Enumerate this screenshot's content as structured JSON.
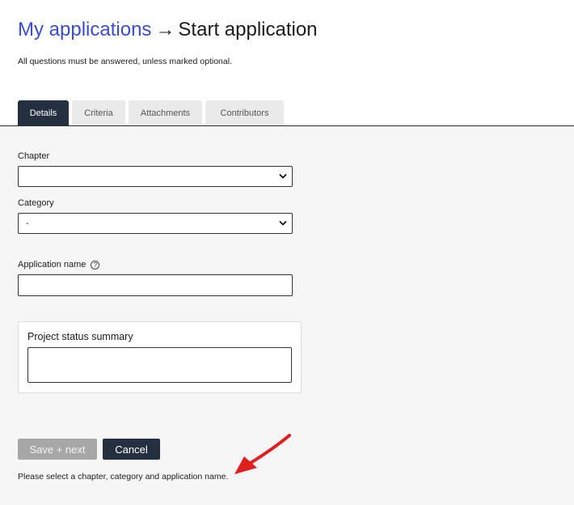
{
  "header": {
    "breadcrumb_link": "My applications",
    "arrow": "→",
    "current": "Start application"
  },
  "intro_text": "All questions must be answered, unless marked optional.",
  "tabs": [
    {
      "label": "Details",
      "active": true
    },
    {
      "label": "Criteria",
      "active": false
    },
    {
      "label": "Attachments",
      "active": false
    },
    {
      "label": "Contributors",
      "active": false
    }
  ],
  "form": {
    "chapter": {
      "label": "Chapter",
      "value": ""
    },
    "category": {
      "label": "Category",
      "value": "-"
    },
    "application_name": {
      "label": "Application name",
      "help_icon": "?",
      "value": ""
    },
    "project_status_summary": {
      "label": "Project status summary",
      "value": ""
    }
  },
  "buttons": {
    "save_next": "Save + next",
    "cancel": "Cancel"
  },
  "hint_text": "Please select a chapter, category and application name.",
  "colors": {
    "link": "#3b4bd8",
    "active_tab": "#243040",
    "disabled_button": "#a7a7a7",
    "annotation_arrow": "#e01e1e"
  },
  "icons": {
    "select_chevron": "chevron-down-icon",
    "help": "question-circle-icon",
    "annotation": "red-arrow-icon"
  }
}
